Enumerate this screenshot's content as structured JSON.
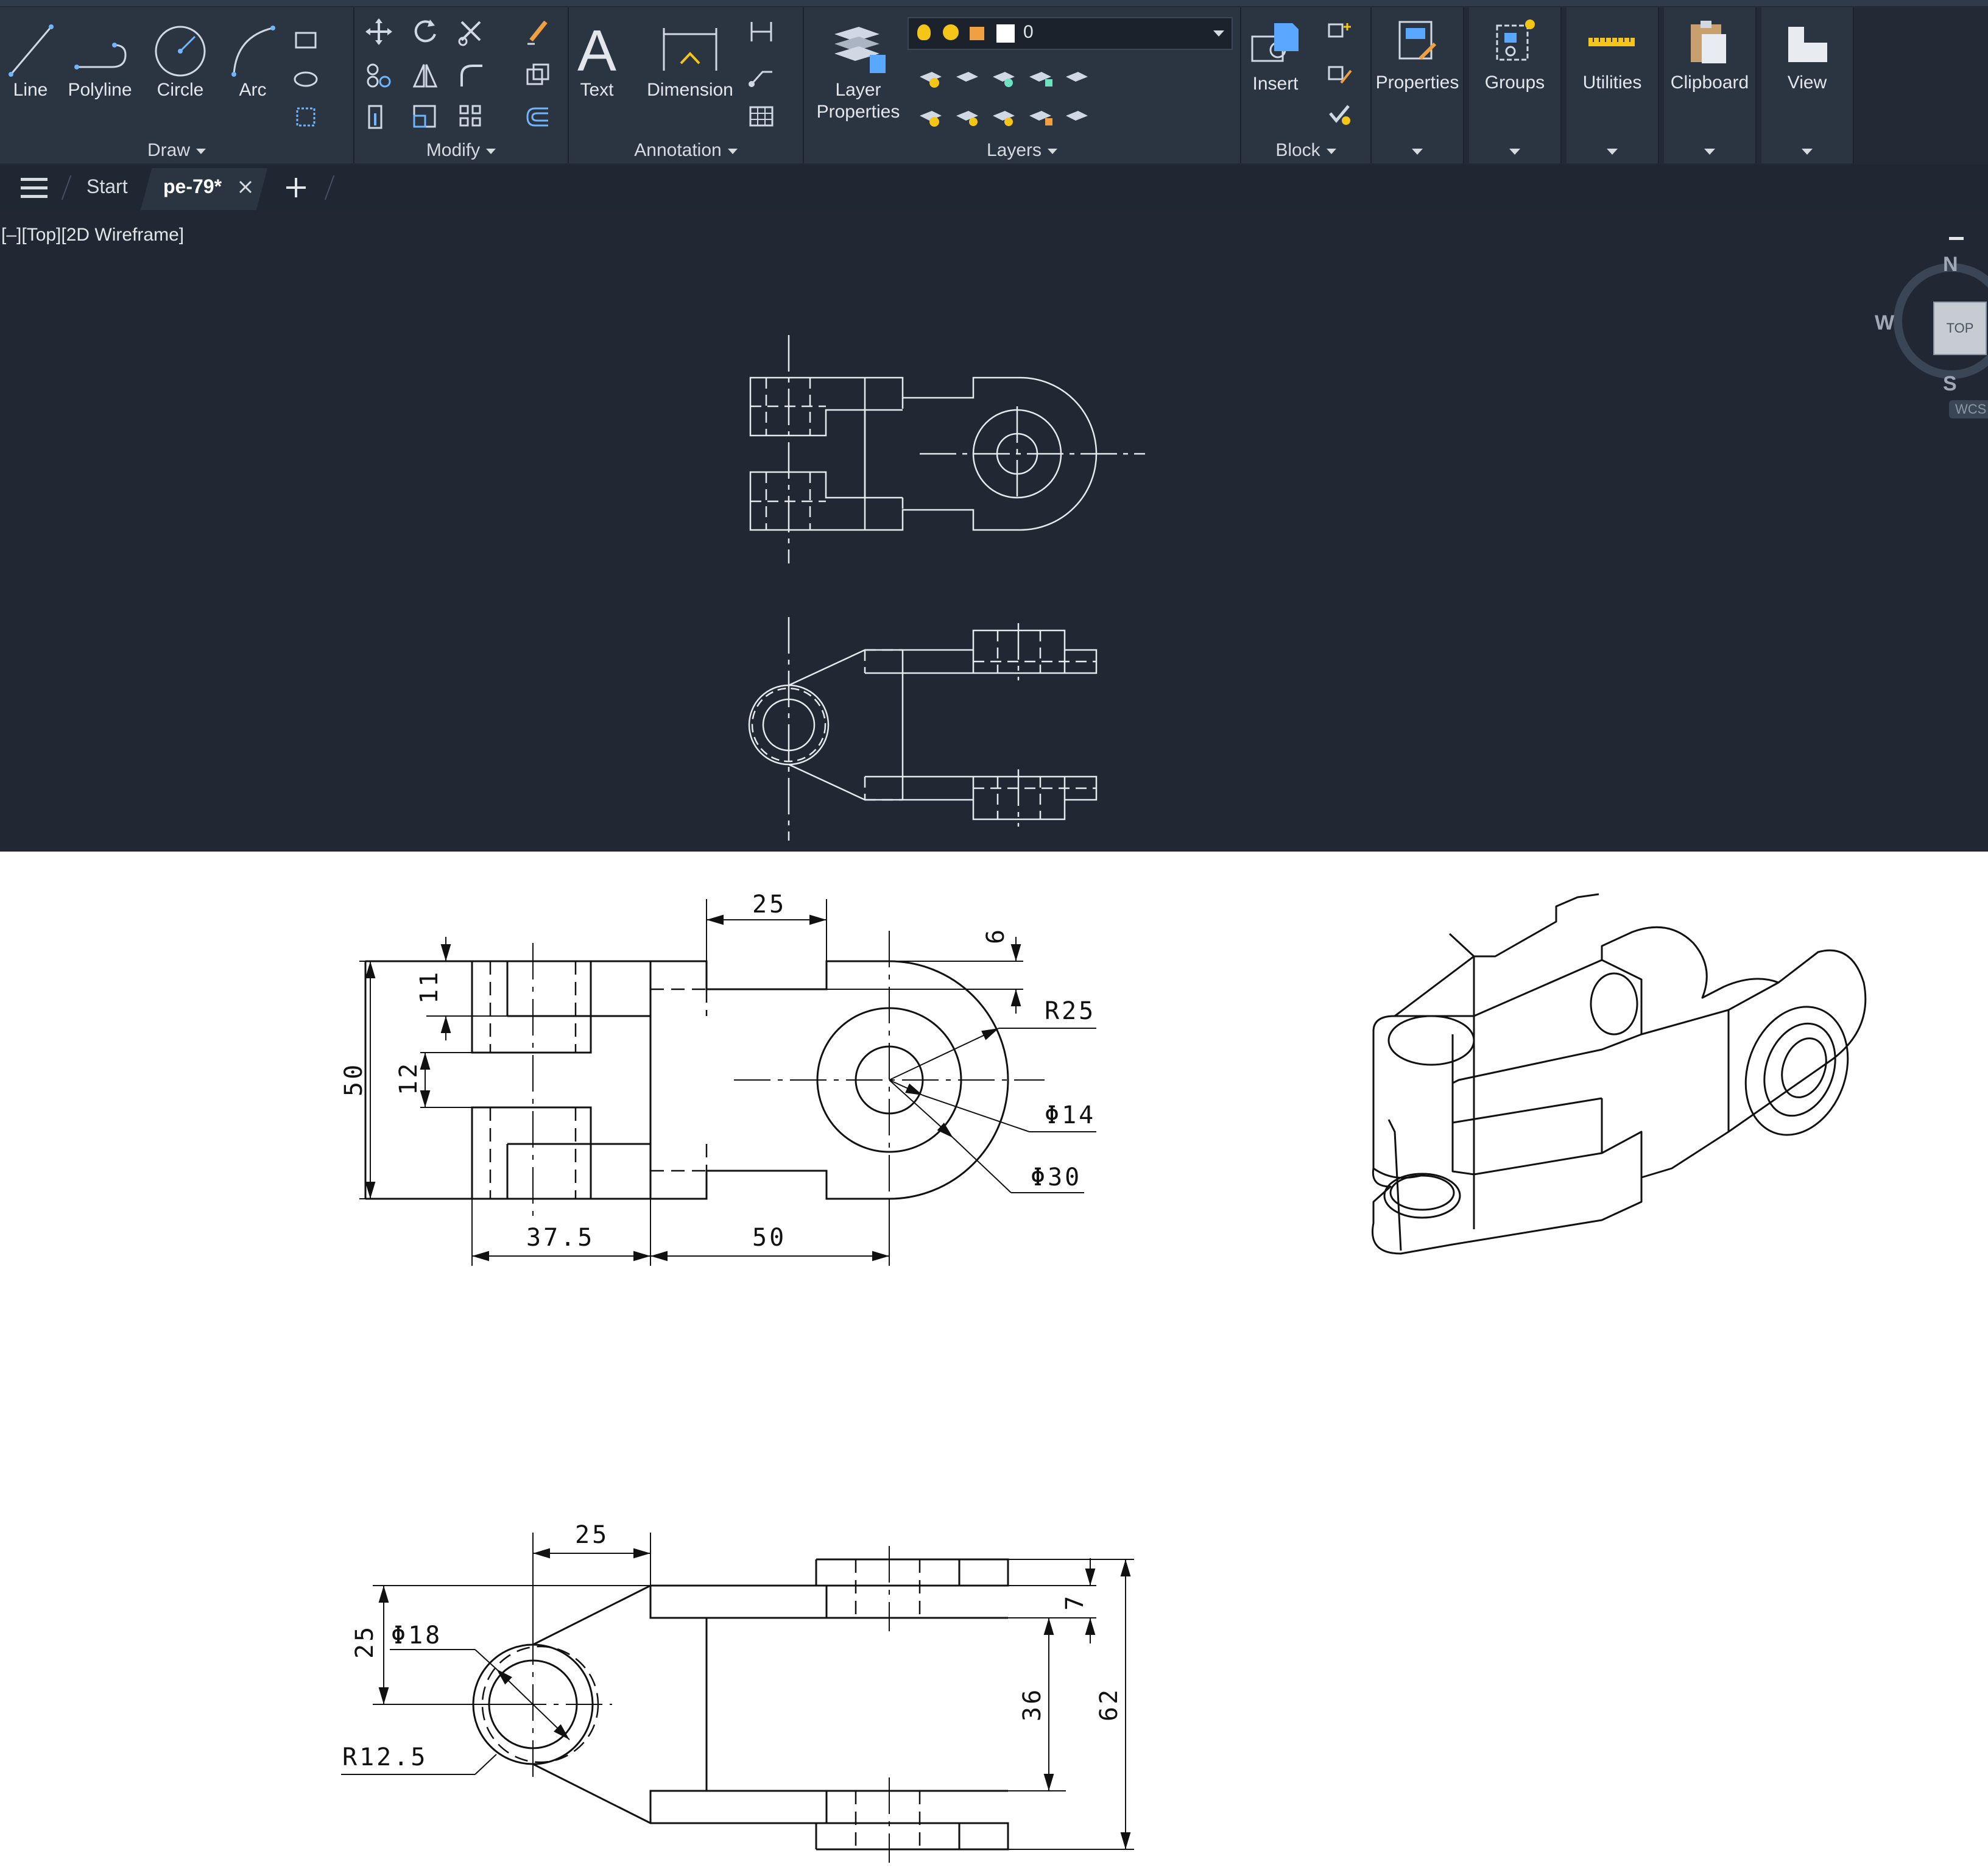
{
  "ribbon": {
    "draw": {
      "title": "Draw",
      "tools": {
        "line": "Line",
        "polyline": "Polyline",
        "circle": "Circle",
        "arc": "Arc"
      }
    },
    "modify": {
      "title": "Modify"
    },
    "annotation": {
      "title": "Annotation",
      "tools": {
        "text": "Text",
        "dimension": "Dimension"
      }
    },
    "layers": {
      "title": "Layers",
      "layer_properties_line1": "Layer",
      "layer_properties_line2": "Properties",
      "current_layer": "0"
    },
    "block": {
      "title": "Block",
      "insert": "Insert"
    },
    "panels": {
      "properties": "Properties",
      "groups": "Groups",
      "utilities": "Utilities",
      "clipboard": "Clipboard",
      "view": "View"
    }
  },
  "tabs": {
    "start": "Start",
    "drawing": "pe-79*"
  },
  "viewport": {
    "label": "[–][Top][2D Wireframe]",
    "compass": {
      "n": "N",
      "w": "W",
      "s": "S",
      "cube": "TOP",
      "wcs": "WCS"
    }
  },
  "reference": {
    "top_view": {
      "dims": {
        "d25": "25",
        "d6": "6",
        "r25": "R25",
        "d11": "11",
        "d12": "12",
        "d50v": "50",
        "phi14": "Φ14",
        "phi30": "Φ30",
        "d37_5": "37.5",
        "d50h": "50"
      }
    },
    "front_view": {
      "dims": {
        "d25h": "25",
        "d25v": "25",
        "phi18": "Φ18",
        "r12_5": "R12.5",
        "d7": "7",
        "d36": "36",
        "d62": "62"
      }
    }
  },
  "colors": {
    "ribbon_bg": "#222a36",
    "panel_bg": "#2b3441",
    "viewport_bg": "#212834",
    "cad_lines": "#e6e9ee",
    "accent_yellow": "#f5c518"
  }
}
